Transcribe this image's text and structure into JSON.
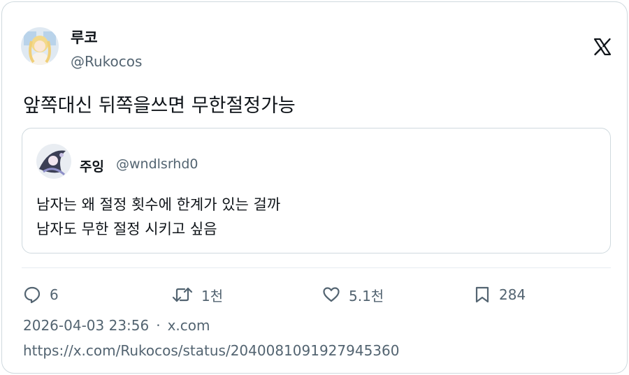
{
  "author": {
    "display_name": "루코",
    "handle": "@Rukocos"
  },
  "brand_icon": "x-logo-icon",
  "tweet": {
    "text": "앞쪽대신 뒤쪽을쓰면 무한절정가능"
  },
  "quoted_tweet": {
    "display_name": "주잉",
    "handle": "@wndlsrhd0",
    "lines": [
      "남자는 왜 절정 횟수에 한계가 있는 걸까",
      "남자도 무한 절정 시키고 싶음"
    ]
  },
  "actions": {
    "reply": {
      "icon": "reply-icon",
      "count": "6"
    },
    "retweet": {
      "icon": "retweet-icon",
      "count": "1천"
    },
    "like": {
      "icon": "heart-icon",
      "count": "5.1천"
    },
    "bookmark": {
      "icon": "bookmark-icon",
      "count": "284"
    }
  },
  "meta": {
    "timestamp": "2026-04-03 23:56",
    "separator": "·",
    "source": "x.com"
  },
  "url": "https://x.com/Rukocos/status/2040081091927945360",
  "colors": {
    "text_primary": "#0f1419",
    "text_secondary": "#536471",
    "border": "#cfd9de"
  }
}
